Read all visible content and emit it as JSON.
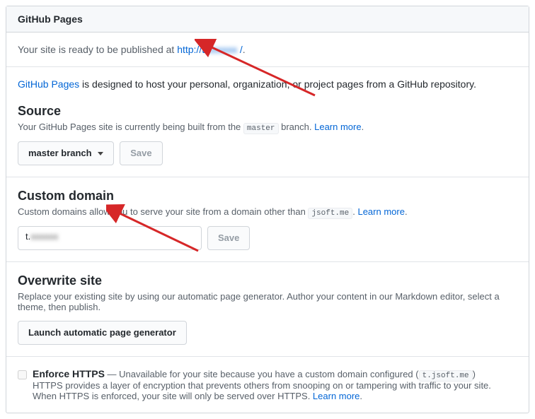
{
  "header": {
    "title": "GitHub Pages"
  },
  "readyMessage": {
    "prefix": "Your site is ready to be published at ",
    "linkPrefix": "http://t.",
    "linkBlur": "xxxxxx",
    "linkSuffix": " /",
    "tail": "."
  },
  "intro": {
    "link": "GitHub Pages",
    "rest": " is designed to host your personal, organization, or project pages from a GitHub repository."
  },
  "source": {
    "heading": "Source",
    "help1": "Your GitHub Pages site is currently being built from the ",
    "branchCode": "master",
    "help2": " branch. ",
    "learnMore": "Learn more",
    "period": ".",
    "selectLabel": "master branch",
    "saveLabel": "Save"
  },
  "customDomain": {
    "heading": "Custom domain",
    "help1": "Custom domains allow you to serve your site from a domain other than ",
    "domainCode": "jsoft.me",
    "period1": ". ",
    "learnMore": "Learn more",
    "period2": ".",
    "valuePrefix": "t.",
    "valueBlur": "xxxxxx",
    "saveLabel": "Save"
  },
  "overwrite": {
    "heading": "Overwrite site",
    "help": "Replace your existing site by using our automatic page generator. Author your content in our Markdown editor, select a theme, then publish.",
    "buttonLabel": "Launch automatic page generator"
  },
  "https": {
    "title": "Enforce HTTPS",
    "dash": " — ",
    "msg1": "Unavailable for your site because you have a custom domain configured (",
    "domainCode": "t.jsoft.me",
    "msg2": ")",
    "line2a": "HTTPS provides a layer of encryption that prevents others from snooping on or tampering with traffic to your site.",
    "line2b": "When HTTPS is enforced, your site will only be served over HTTPS. ",
    "learnMore": "Learn more",
    "period": "."
  }
}
